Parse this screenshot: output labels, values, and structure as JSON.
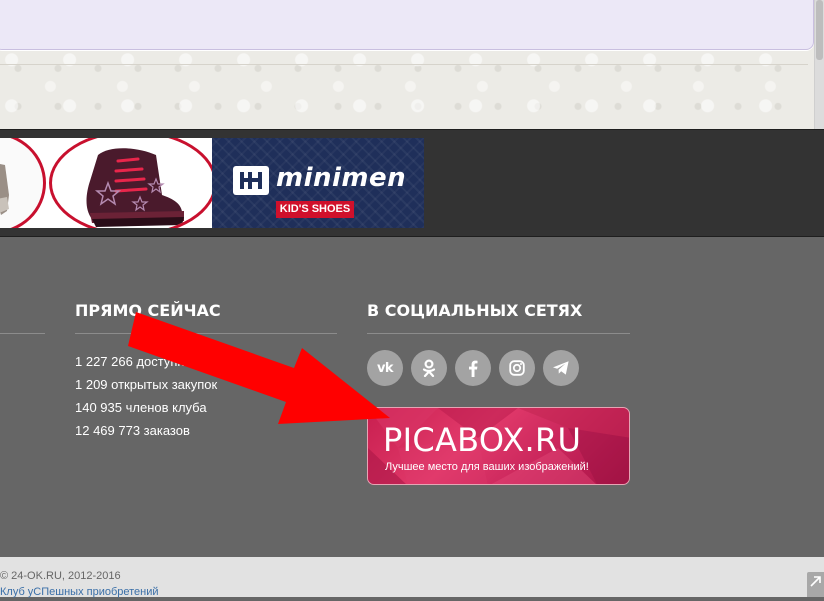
{
  "banner": {
    "brand_name": "minimen",
    "brand_tag": "KID'S SHOES"
  },
  "widgets": {
    "now": {
      "title": "ПРЯМО СЕЙЧАС",
      "stats": [
        "1 227 266 доступных",
        "1 209 открытых закупок",
        "140 935 членов клуба",
        "12 469 773 заказов"
      ]
    },
    "social": {
      "title": "В СОЦИАЛЬНЫХ СЕТЯХ",
      "vk_label": "vk",
      "icons": [
        "vk-icon",
        "odnoklassniki-icon",
        "facebook-icon",
        "instagram-icon",
        "telegram-icon"
      ]
    },
    "picabox": {
      "title": "PICABOX.RU",
      "subtitle": "Лучшее место для ваших изображений!"
    }
  },
  "footer": {
    "copyright": "© 24-OK.RU, 2012-2016",
    "club_link": "Клуб уСПешных приобретений"
  },
  "colors": {
    "footer_bg": "#666666",
    "banner_band_bg": "#333333",
    "social_icon_bg": "#a3a3a3",
    "picabox_pink": "#d62c5f",
    "arrow_red": "#ff0000",
    "link_blue": "#3a6fa8",
    "brand_navy": "#1f2f5a",
    "brand_red": "#d0102b"
  }
}
